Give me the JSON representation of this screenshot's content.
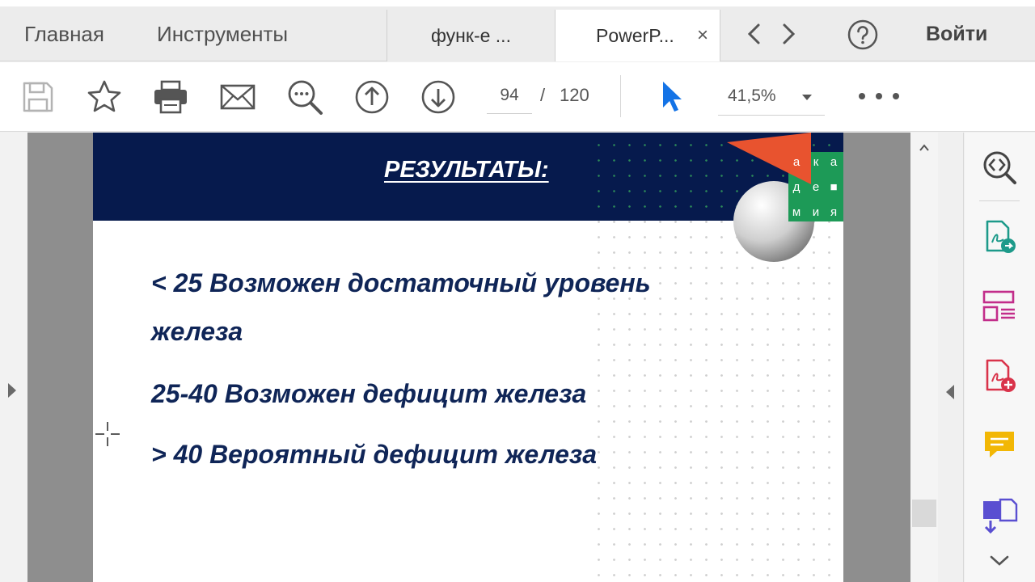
{
  "nav": {
    "home": "Главная",
    "tools": "Инструменты",
    "login": "Войти"
  },
  "tabs": [
    {
      "label": "функ-е ..."
    },
    {
      "label": "PowerP...",
      "close": "×"
    }
  ],
  "toolbar": {
    "page_current": "94",
    "page_sep": "/",
    "page_total": "120",
    "zoom": "41,5%"
  },
  "slide": {
    "title": "РЕЗУЛЬТАТЫ:",
    "logo_letters": [
      "а",
      "к",
      "а",
      "д",
      "е",
      "■",
      "м",
      "и",
      "я"
    ],
    "lines": [
      "< 25 Возможен достаточный уровень",
      "железа",
      "25-40 Возможен дефицит железа",
      "> 40 Вероятный дефицит железа"
    ]
  },
  "colors": {
    "slide_header": "#061a4d",
    "slide_text": "#0f2557",
    "logo_orange": "#e8532f",
    "logo_green": "#1d9a57",
    "cursor_blue": "#1473e6"
  },
  "icons": {
    "toolbar": [
      "save-icon",
      "bookmark-star-icon",
      "print-icon",
      "email-icon",
      "zoom-search-icon",
      "page-up-icon",
      "page-down-icon",
      "select-cursor-icon",
      "more-icon"
    ],
    "panel": [
      "zoom-panel-icon",
      "export-pdf-icon",
      "organize-pages-icon",
      "create-pdf-icon",
      "comment-icon",
      "send-pdf-icon"
    ]
  }
}
